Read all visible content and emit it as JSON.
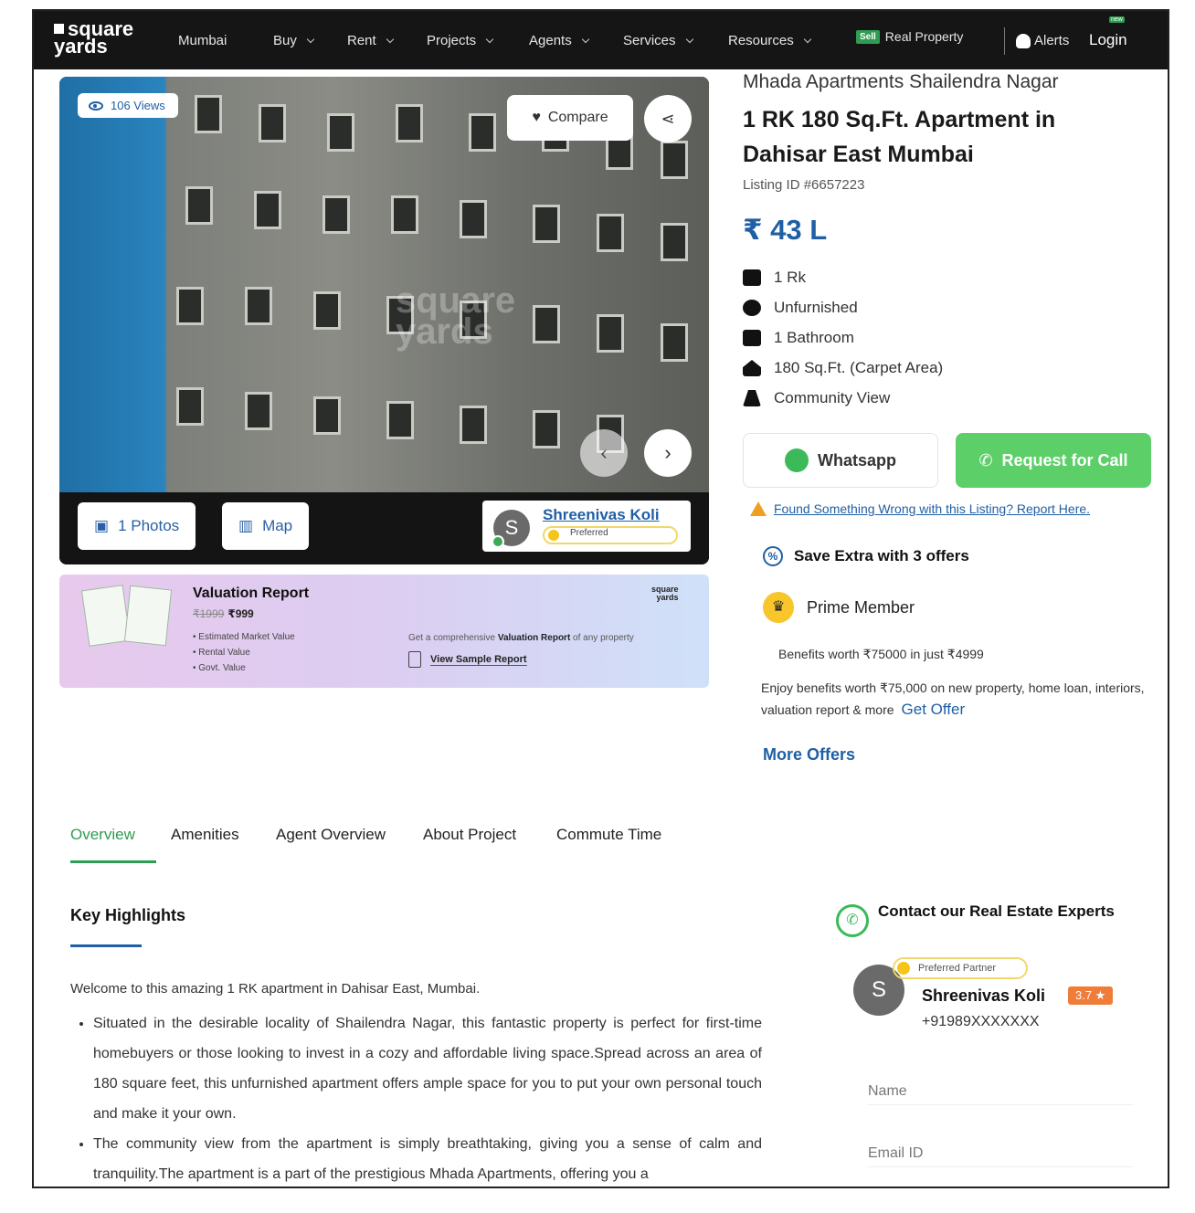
{
  "nav": {
    "logo_line1": "square",
    "logo_line2": "yards",
    "city": "Mumbai",
    "items": [
      {
        "label": "Buy"
      },
      {
        "label": "Rent"
      },
      {
        "label": "Projects"
      },
      {
        "label": "Agents"
      },
      {
        "label": "Services"
      },
      {
        "label": "Resources"
      }
    ],
    "sell_badge": "Sell",
    "sell_label": "Real Property",
    "alerts_label": "Alerts",
    "login_badge": "new",
    "login_label": "Login"
  },
  "gallery": {
    "views": "106 Views",
    "compare_label": "Compare",
    "photos_label": "1 Photos",
    "map_label": "Map",
    "watermark_line1": "square",
    "watermark_line2": "yards",
    "agent": {
      "initial": "S",
      "name": "Shreenivas Koli",
      "badge": "Preferred"
    }
  },
  "valuation": {
    "title": "Valuation Report",
    "old_price": "₹1999",
    "price": "₹999",
    "bullets": [
      "Estimated Market Value",
      "Rental Value",
      "Govt. Value"
    ],
    "logo_line1": "square",
    "logo_line2": "yards",
    "desc_pre": "Get a comprehensive ",
    "desc_bold": "Valuation Report",
    "desc_post": " of any property",
    "link": "View Sample Report"
  },
  "listing": {
    "project": "Mhada Apartments Shailendra Nagar",
    "title": "1 RK 180 Sq.Ft. Apartment in Dahisar East Mumbai",
    "listing_id": "Listing ID #6657223",
    "price": "₹ 43 L",
    "features": [
      {
        "icon": "bed-icon",
        "label": "1 Rk"
      },
      {
        "icon": "sofa-icon",
        "label": "Unfurnished"
      },
      {
        "icon": "bathtub-icon",
        "label": "1 Bathroom"
      },
      {
        "icon": "home-icon",
        "label": "180 Sq.Ft. (Carpet Area)"
      },
      {
        "icon": "community-icon",
        "label": "Community View"
      }
    ],
    "whatsapp_label": "Whatsapp",
    "call_label": "Request for Call",
    "report_label": "Found Something Wrong with this Listing? Report Here.",
    "offers_label": "Save Extra with 3 offers",
    "prime_label": "Prime Member",
    "benefits": "Benefits worth ₹75000 in just ₹4999",
    "enjoy": "Enjoy benefits worth ₹75,000 on new property, home loan, interiors, valuation report & more",
    "get_offer": "Get Offer",
    "more_offers": "More Offers"
  },
  "tabs": [
    {
      "label": "Overview"
    },
    {
      "label": "Amenities"
    },
    {
      "label": "Agent Overview"
    },
    {
      "label": "About Project"
    },
    {
      "label": "Commute Time"
    }
  ],
  "highlights": {
    "title": "Key Highlights",
    "intro": "Welcome to this amazing 1 RK apartment in Dahisar East, Mumbai.",
    "bullets": [
      "Situated in the desirable locality of Shailendra Nagar, this fantastic property is perfect for first-time homebuyers or those looking to invest in a cozy and affordable living space.Spread across an area of 180 square feet, this unfurnished apartment offers ample space for you to put your own personal touch and make it your own.",
      "The community view from the apartment is simply breathtaking, giving you a sense of calm and tranquility.The apartment is a part of the prestigious Mhada Apartments, offering you a"
    ]
  },
  "contact": {
    "title": "Contact our Real Estate Experts",
    "initial": "S",
    "badge": "Preferred Partner",
    "name": "Shreenivas Koli",
    "rating": "3.7 ★",
    "phone": "+91989XXXXXXX",
    "name_placeholder": "Name",
    "email_placeholder": "Email ID"
  },
  "colors": {
    "primary_blue": "#1f5fa5",
    "green": "#2e9c52",
    "call_green": "#5ccf68",
    "nav_bg": "#151515"
  }
}
